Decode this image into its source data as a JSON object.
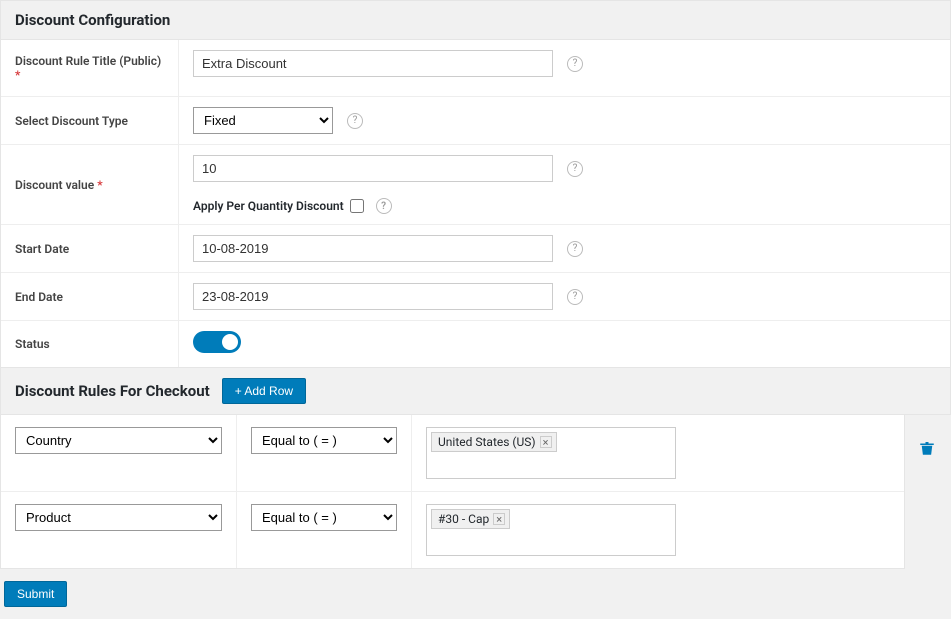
{
  "config_header": "Discount Configuration",
  "form": {
    "title_label": "Discount Rule Title (Public)",
    "title_value": "Extra Discount",
    "type_label": "Select Discount Type",
    "type_value": "Fixed",
    "value_label": "Discount value",
    "value_value": "10",
    "per_qty_label": "Apply Per Quantity Discount",
    "start_label": "Start Date",
    "start_value": "10-08-2019",
    "end_label": "End Date",
    "end_value": "23-08-2019",
    "status_label": "Status"
  },
  "rules_header": "Discount Rules For Checkout",
  "add_row_label": "+ Add Row",
  "rules": {
    "0": {
      "condition": "Country",
      "operator": "Equal to ( = )",
      "value": "United States (US)"
    },
    "1": {
      "condition": "Product",
      "operator": "Equal to ( = )",
      "value": "#30 - Cap"
    }
  },
  "submit_label": "Submit"
}
